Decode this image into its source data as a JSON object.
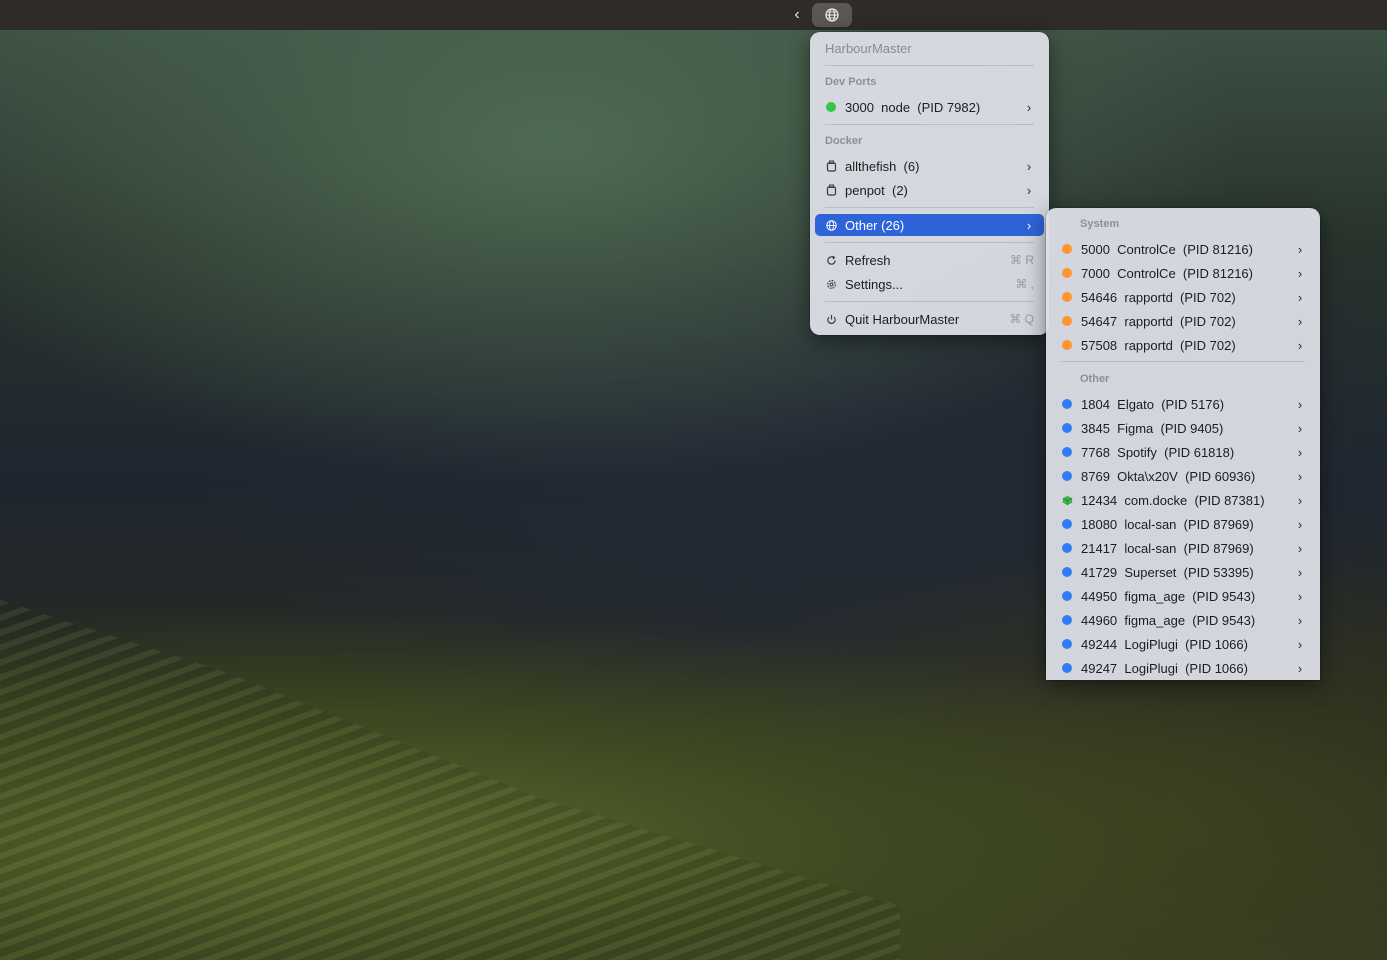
{
  "menubar": {
    "chevron_icon": "chevron-left-icon",
    "status_icon": "globe-icon"
  },
  "main_menu": {
    "app_title": "HarbourMaster",
    "dev_ports": {
      "header": "Dev Ports",
      "items": [
        {
          "label": "3000  node  (PID 7982)",
          "status": "green"
        }
      ]
    },
    "docker": {
      "header": "Docker",
      "items": [
        {
          "label": "allthefish  (6)",
          "icon": "container-icon"
        },
        {
          "label": "penpot  (2)",
          "icon": "container-icon"
        }
      ]
    },
    "other": {
      "label": "Other (26)",
      "icon": "globe-icon"
    },
    "refresh": {
      "label": "Refresh",
      "shortcut": "⌘ R",
      "icon": "refresh-icon"
    },
    "settings": {
      "label": "Settings...",
      "shortcut": "⌘ ,",
      "icon": "gear-icon"
    },
    "quit": {
      "label": "Quit HarbourMaster",
      "shortcut": "⌘ Q",
      "icon": "power-icon"
    }
  },
  "sub_menu": {
    "system": {
      "header": "System",
      "items": [
        {
          "label": "5000  ControlCe  (PID 81216)",
          "status": "orange"
        },
        {
          "label": "7000  ControlCe  (PID 81216)",
          "status": "orange"
        },
        {
          "label": "54646  rapportd  (PID 702)",
          "status": "orange"
        },
        {
          "label": "54647  rapportd  (PID 702)",
          "status": "orange"
        },
        {
          "label": "57508  rapportd  (PID 702)",
          "status": "orange"
        }
      ]
    },
    "other": {
      "header": "Other",
      "items": [
        {
          "label": "1804  Elgato  (PID 5176)",
          "status": "blue"
        },
        {
          "label": "3845  Figma  (PID 9405)",
          "status": "blue"
        },
        {
          "label": "7768  Spotify  (PID 61818)",
          "status": "blue"
        },
        {
          "label": "8769  Okta\\x20V  (PID 60936)",
          "status": "blue"
        },
        {
          "label": "12434  com.docke  (PID 87381)",
          "status": "docker",
          "icon": "cube-icon"
        },
        {
          "label": "18080  local-san  (PID 87969)",
          "status": "blue"
        },
        {
          "label": "21417  local-san  (PID 87969)",
          "status": "blue"
        },
        {
          "label": "41729  Superset  (PID 53395)",
          "status": "blue"
        },
        {
          "label": "44950  figma_age  (PID 9543)",
          "status": "blue"
        },
        {
          "label": "44960  figma_age  (PID 9543)",
          "status": "blue"
        },
        {
          "label": "49244  LogiPlugi  (PID 1066)",
          "status": "blue"
        },
        {
          "label": "49247  LogiPlugi  (PID 1066)",
          "status": "blue"
        }
      ]
    }
  },
  "colors": {
    "highlight": "#2f64d9",
    "status_green": "#33c748",
    "status_orange": "#ff9430",
    "status_blue": "#2f7cf6"
  }
}
